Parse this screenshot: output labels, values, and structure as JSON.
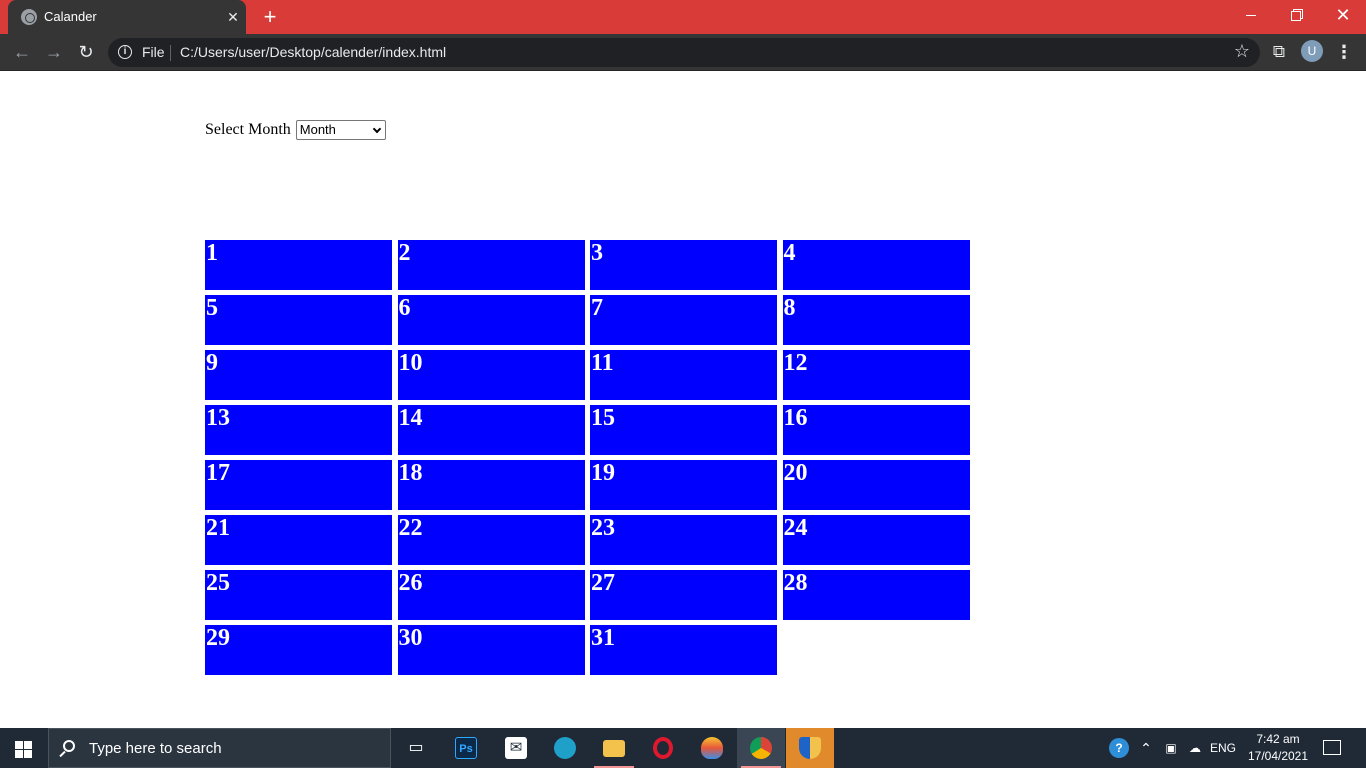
{
  "browser": {
    "tab_title": "Calander",
    "new_tab_label": "+",
    "url_scheme": "File",
    "url": "C:/Users/user/Desktop/calender/index.html",
    "avatar_initial": "U"
  },
  "page": {
    "select_label": "Select Month",
    "select_value": "Month",
    "days": [
      "1",
      "2",
      "3",
      "4",
      "5",
      "6",
      "7",
      "8",
      "9",
      "10",
      "11",
      "12",
      "13",
      "14",
      "15",
      "16",
      "17",
      "18",
      "19",
      "20",
      "21",
      "22",
      "23",
      "24",
      "25",
      "26",
      "27",
      "28",
      "29",
      "30",
      "31"
    ],
    "cell_color": "#0000ff",
    "text_color": "#ffffff"
  },
  "taskbar": {
    "search_placeholder": "Type here to search",
    "apps": [
      "task-view",
      "photoshop",
      "mail",
      "edge",
      "file-explorer",
      "opera",
      "paint",
      "chrome",
      "security"
    ],
    "language": "ENG",
    "time": "7:42 am",
    "date": "17/04/2021"
  }
}
